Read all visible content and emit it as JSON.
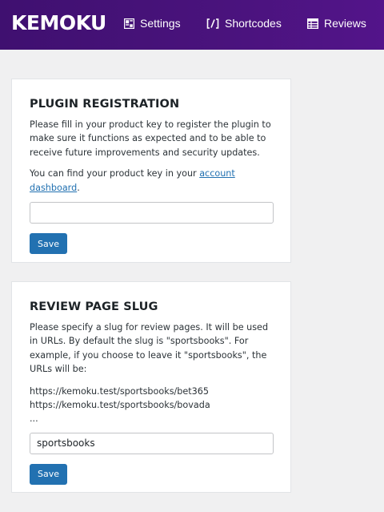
{
  "header": {
    "logo": "KEMOKU",
    "nav": [
      {
        "label": "Settings",
        "icon": "settings-grid-icon"
      },
      {
        "label": "Shortcodes",
        "icon": "shortcode-brackets-icon"
      },
      {
        "label": "Reviews",
        "icon": "reviews-table-icon"
      }
    ]
  },
  "registration": {
    "title": "PLUGIN REGISTRATION",
    "description": "Please fill in your product key to register the plugin to make sure it functions as expected and to be able to receive future improvements and security updates.",
    "hint_prefix": "You can find your product key in your ",
    "hint_link": "account dashboard",
    "hint_suffix": ".",
    "input_value": "",
    "save_label": "Save"
  },
  "slug": {
    "title": "REVIEW PAGE SLUG",
    "description": "Please specify a slug for review pages. It will be used in URLs. By default the slug is \"sportsbooks\". For example, if you choose to leave it \"sportsbooks\", the URLs will be:",
    "example_urls": [
      "https://kemoku.test/sportsbooks/bet365",
      "https://kemoku.test/sportsbooks/bovada",
      "..."
    ],
    "input_value": "sportsbooks",
    "save_label": "Save"
  },
  "colors": {
    "header_bg": "#4a137d",
    "accent": "#2271b1",
    "page_bg": "#f0f0f1"
  }
}
